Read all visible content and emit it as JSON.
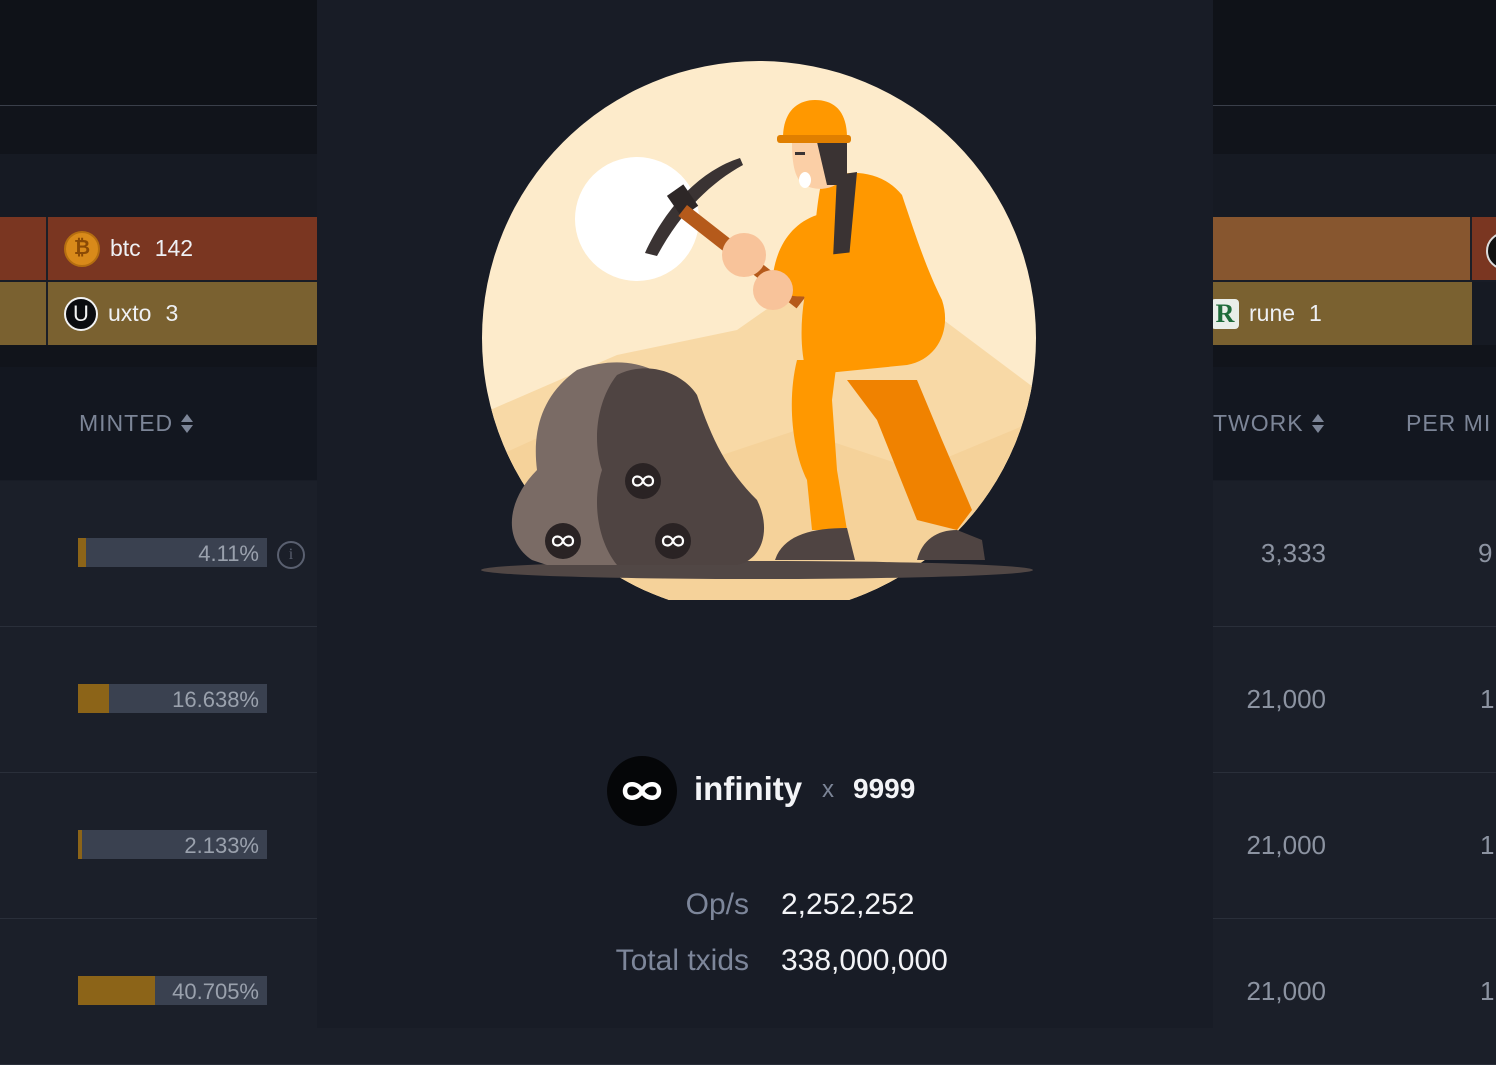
{
  "tokens": {
    "btc": {
      "name": "btc",
      "count": "142",
      "icon": "bitcoin-icon",
      "symbol": "₿"
    },
    "uxto": {
      "name": "uxto",
      "count": "3",
      "icon": "u-icon",
      "symbol": "U"
    },
    "rune": {
      "name": "rune",
      "count": "1",
      "icon": "rune-icon",
      "symbol": "R"
    }
  },
  "table": {
    "headers": {
      "minted": "MINTED",
      "network": "TWORK",
      "per_mint": "PER MI"
    },
    "rows": [
      {
        "minted_pct": "4.11%",
        "minted_fraction": 0.0411,
        "network": "3,333",
        "per_mint": "9"
      },
      {
        "minted_pct": "16.638%",
        "minted_fraction": 0.16638,
        "network": "21,000",
        "per_mint": "1,"
      },
      {
        "minted_pct": "2.133%",
        "minted_fraction": 0.02133,
        "network": "21,000",
        "per_mint": "1,"
      },
      {
        "minted_pct": "40.705%",
        "minted_fraction": 0.40705,
        "network": "21,000",
        "per_mint": "1,"
      }
    ]
  },
  "modal": {
    "token_icon": "infinity-icon",
    "token_name": "infinity",
    "multiplier_sign": "x",
    "token_count": "9999",
    "stats": [
      {
        "label": "Op/s",
        "value": "2,252,252"
      },
      {
        "label": "Total txids",
        "value": "338,000,000"
      }
    ]
  },
  "colors": {
    "btc_row": "#7a3621",
    "uxto_row": "#7a6130",
    "progress_fill": "#8c6418",
    "modal_bg": "#181c26",
    "miner_orange": "#ff9800"
  }
}
